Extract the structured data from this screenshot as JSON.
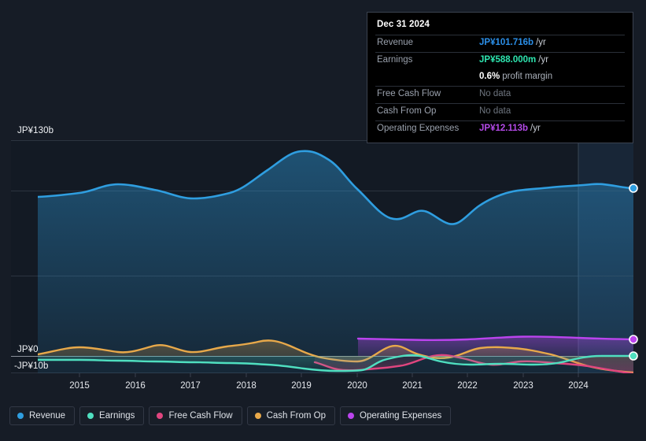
{
  "tooltip": {
    "date": "Dec 31 2024",
    "rows": [
      {
        "label": "Revenue",
        "value": "JP¥101.716b",
        "unit": "/yr",
        "color": "#2b8fe8"
      },
      {
        "label": "Earnings",
        "value": "JP¥588.000m",
        "unit": "/yr",
        "color": "#2ee6b0"
      },
      {
        "label": "",
        "value": "0.6%",
        "unit": "profit margin",
        "color": "#ffffff",
        "sub": true
      },
      {
        "label": "Free Cash Flow",
        "value": "No data",
        "unit": "",
        "color": "#6e757f",
        "nodata": true
      },
      {
        "label": "Cash From Op",
        "value": "No data",
        "unit": "",
        "color": "#6e757f",
        "nodata": true
      },
      {
        "label": "Operating Expenses",
        "value": "JP¥12.113b",
        "unit": "/yr",
        "color": "#b44ae8"
      }
    ]
  },
  "axis": {
    "y_labels": {
      "top": "JP¥130b",
      "zero": "JP¥0",
      "negative": "-JP¥10b"
    },
    "x_labels": [
      "2015",
      "2016",
      "2017",
      "2018",
      "2019",
      "2020",
      "2021",
      "2022",
      "2023",
      "2024"
    ]
  },
  "legend": {
    "items": [
      {
        "label": "Revenue",
        "color": "#2f9ee0"
      },
      {
        "label": "Earnings",
        "color": "#4fdfc0"
      },
      {
        "label": "Free Cash Flow",
        "color": "#e0457f"
      },
      {
        "label": "Cash From Op",
        "color": "#e8a94a"
      },
      {
        "label": "Operating Expenses",
        "color": "#bb44ee"
      }
    ]
  },
  "chart_data": {
    "type": "area",
    "title": "",
    "xlabel": "",
    "ylabel": "",
    "ylim": [
      -10,
      130
    ],
    "y_ticks": [
      130,
      0,
      -10
    ],
    "x_ticks": [
      "2015",
      "2016",
      "2017",
      "2018",
      "2019",
      "2020",
      "2021",
      "2022",
      "2023",
      "2024"
    ],
    "currency": "JP¥",
    "units": "b",
    "grid": true,
    "legend_position": "bottom",
    "forecast_start": "2024.0",
    "series": [
      {
        "name": "Revenue",
        "color": "#2f9ee0",
        "x": [
          2014.3,
          2014.8,
          2015.3,
          2015.8,
          2016.3,
          2016.8,
          2017.3,
          2017.8,
          2018.3,
          2018.8,
          2019.2,
          2019.7,
          2020.1,
          2020.6,
          2021.0,
          2021.4,
          2021.8,
          2022.2,
          2022.7,
          2023.2,
          2023.7,
          2024.2,
          2024.8
        ],
        "values": [
          94.5,
          94.0,
          95.0,
          99.5,
          100.5,
          97.5,
          94.0,
          94.0,
          97.0,
          106.0,
          121.5,
          118.0,
          112.0,
          95.0,
          88.0,
          86.5,
          89.5,
          84.0,
          90.0,
          96.5,
          98.5,
          100.0,
          101.716
        ]
      },
      {
        "name": "Earnings",
        "color": "#4fdfc0",
        "x": [
          2014.3,
          2015.0,
          2015.8,
          2016.5,
          2017.3,
          2018.0,
          2018.8,
          2019.5,
          2020.0,
          2020.6,
          2021.1,
          2021.7,
          2022.2,
          2022.8,
          2023.4,
          2024.0,
          2024.8
        ],
        "values": [
          -2.0,
          -2.2,
          -2.0,
          -2.4,
          -2.5,
          -2.5,
          -3.0,
          -4.5,
          -4.6,
          -1.0,
          0.2,
          -1.6,
          -2.5,
          -2.5,
          -2.6,
          -1.0,
          0.588
        ]
      },
      {
        "name": "Free Cash Flow",
        "color": "#e0457f",
        "x": [
          2019.4,
          2019.8,
          2020.2,
          2020.7,
          2021.2,
          2021.6,
          2022.1,
          2022.6,
          2023.1,
          2023.6,
          2024.1,
          2024.6
        ],
        "values": [
          -4.0,
          -6.5,
          -6.0,
          -6.5,
          -2.5,
          0.0,
          -2.5,
          -2.0,
          -2.2,
          -2.6,
          -4.5,
          -6.0
        ]
      },
      {
        "name": "Cash From Op",
        "color": "#e8a94a",
        "x": [
          2014.3,
          2015.0,
          2015.7,
          2016.4,
          2017.1,
          2017.6,
          2018.2,
          2018.8,
          2019.3,
          2019.9,
          2020.4,
          2021.0,
          2021.5,
          2022.0,
          2022.5,
          2023.1,
          2023.7,
          2024.2,
          2024.7
        ],
        "values": [
          0.6,
          1.6,
          1.4,
          0.4,
          2.0,
          0.6,
          1.8,
          3.0,
          1.0,
          -0.6,
          -1.4,
          2.0,
          0.4,
          -0.4,
          1.4,
          1.6,
          0.8,
          -1.5,
          -3.0
        ]
      },
      {
        "name": "Operating Expenses",
        "color": "#bb44ee",
        "x": [
          2020.0,
          2020.6,
          2021.2,
          2021.8,
          2022.4,
          2023.0,
          2023.6,
          2024.2,
          2024.8
        ],
        "values": [
          12.8,
          12.4,
          12.2,
          12.3,
          12.6,
          13.1,
          12.9,
          12.5,
          12.113
        ]
      }
    ]
  }
}
